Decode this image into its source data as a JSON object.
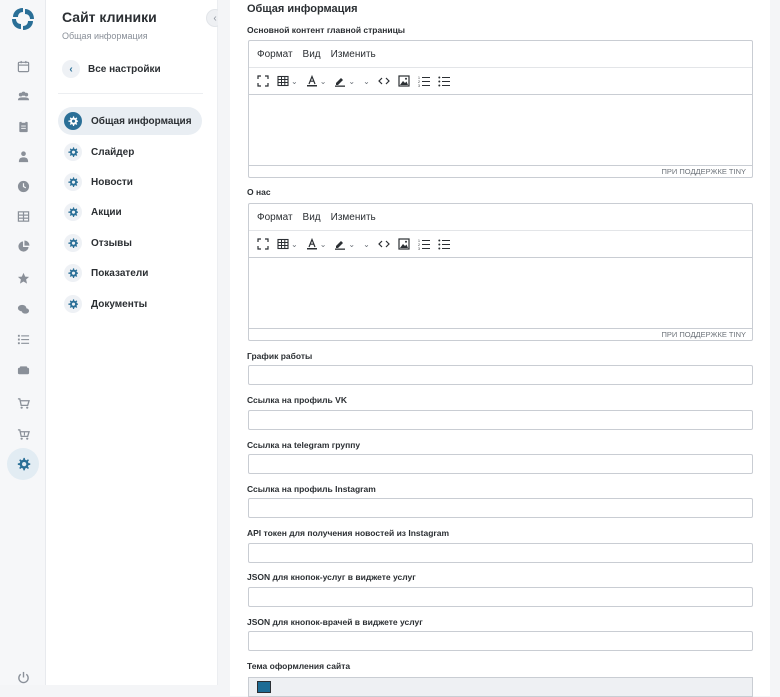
{
  "sidebar": {
    "title": "Сайт клиники",
    "subtitle": "Общая информация",
    "back_label": "Все настройки",
    "items": [
      {
        "label": "Общая информация",
        "active": true
      },
      {
        "label": "Слайдер"
      },
      {
        "label": "Новости"
      },
      {
        "label": "Акции"
      },
      {
        "label": "Отзывы"
      },
      {
        "label": "Показатели"
      },
      {
        "label": "Документы"
      }
    ]
  },
  "rail": {
    "icons": [
      "calendar-icon",
      "users-icon",
      "clipboard-icon",
      "doctor-icon",
      "clock-icon",
      "table-icon",
      "pie-chart-icon",
      "star-icon",
      "chat-icon",
      "list-icon",
      "wallet-icon",
      "cart-icon",
      "cart-plus-icon",
      "gear-icon"
    ],
    "active": "gear-icon"
  },
  "main": {
    "section_title": "Общая информация",
    "editor1": {
      "label": "Основной контент главной страницы",
      "menu": [
        "Формат",
        "Вид",
        "Изменить"
      ],
      "status": "ПРИ ПОДДЕРЖКЕ TINY"
    },
    "editor2": {
      "label": "О нас",
      "menu": [
        "Формат",
        "Вид",
        "Изменить"
      ],
      "status": "ПРИ ПОДДЕРЖКЕ TINY"
    },
    "fields": [
      {
        "label": "График работы",
        "value": ""
      },
      {
        "label": "Ссылка на профиль VK",
        "value": ""
      },
      {
        "label": "Ссылка на telegram группу",
        "value": ""
      },
      {
        "label": "Ссылка на профиль Instagram",
        "value": ""
      },
      {
        "label": "API токен для получения новостей из Instagram",
        "value": ""
      },
      {
        "label": "JSON для кнопок-услуг в виджете услуг",
        "value": ""
      },
      {
        "label": "JSON для кнопок-врачей в виджете услуг",
        "value": ""
      }
    ],
    "theme_label": "Тема оформления сайта",
    "theme_color": "#1d6c95"
  },
  "colors": {
    "accent": "#2a6f97"
  }
}
